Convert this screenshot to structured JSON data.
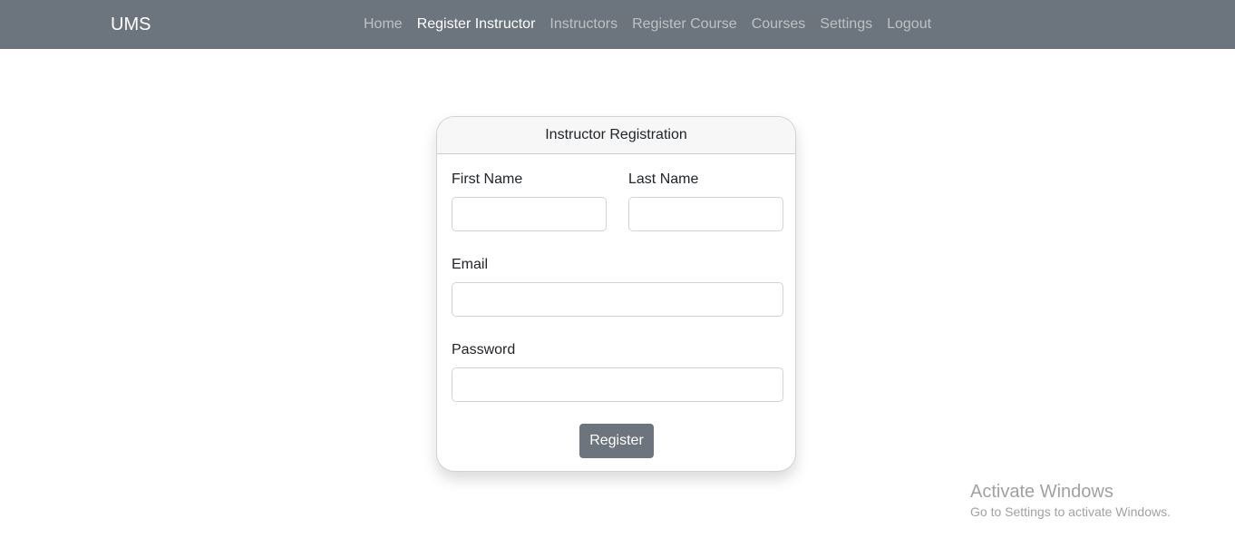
{
  "navbar": {
    "brand": "UMS",
    "items": [
      {
        "label": "Home",
        "active": false
      },
      {
        "label": "Register Instructor",
        "active": true
      },
      {
        "label": "Instructors",
        "active": false
      },
      {
        "label": "Register Course",
        "active": false
      },
      {
        "label": "Courses",
        "active": false
      },
      {
        "label": "Settings",
        "active": false
      },
      {
        "label": "Logout",
        "active": false
      }
    ]
  },
  "form": {
    "title": "Instructor Registration",
    "first_name_label": "First Name",
    "first_name_value": "",
    "last_name_label": "Last Name",
    "last_name_value": "",
    "email_label": "Email",
    "email_value": "",
    "password_label": "Password",
    "password_value": "",
    "submit_label": "Register"
  },
  "watermark": {
    "title": "Activate Windows",
    "subtitle": "Go to Settings to activate Windows."
  },
  "colors": {
    "navbar_bg": "#6c757d",
    "button_bg": "#6c757d",
    "card_header_bg": "#f7f7f7"
  }
}
